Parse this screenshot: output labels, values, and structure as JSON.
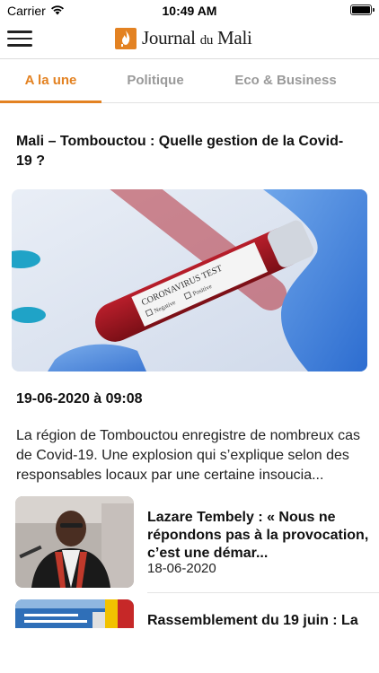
{
  "status_bar": {
    "carrier": "Carrier",
    "time": "10:49 AM",
    "wifi_icon": "wifi-icon",
    "battery_icon": "battery-icon"
  },
  "header": {
    "menu_icon": "hamburger-menu-icon",
    "brand_name": "Journal",
    "brand_connector": "du",
    "brand_suffix": "Mali",
    "brand_color": "#e38222"
  },
  "tabs": [
    {
      "label": "A la une",
      "active": true
    },
    {
      "label": "Politique",
      "active": false
    },
    {
      "label": "Eco & Business",
      "active": false
    }
  ],
  "featured": {
    "title": "Mali – Tombouctou : Quelle gestion de la Covid-19 ?",
    "image_label": "CORONAVIRUS TEST",
    "image_option_negative": "Negative",
    "image_option_positive": "Positive",
    "date": "19-06-2020 à 09:08",
    "excerpt": "La région de Tombouctou enregistre de nombreux cas de Covid-19. Une explosion qui s’explique selon des responsables locaux par une certaine insoucia..."
  },
  "articles": [
    {
      "title": "Lazare Tembely : « Nous ne répondons pas à la provocation, c’est une démar...",
      "date": "18-06-2020"
    },
    {
      "title": "Rassemblement du 19 juin : La",
      "date": ""
    }
  ],
  "colors": {
    "accent": "#e38222",
    "inactive_tab": "#9a9a9a"
  }
}
